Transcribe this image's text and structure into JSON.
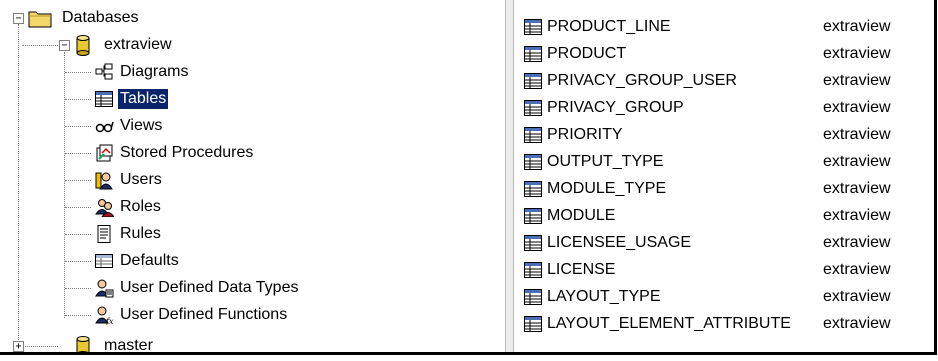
{
  "tree": {
    "root": {
      "label": "Databases",
      "expander": "−"
    },
    "database": {
      "label": "extraview",
      "expander": "−"
    },
    "items": [
      {
        "label": "Diagrams",
        "icon": "diagram-icon"
      },
      {
        "label": "Tables",
        "icon": "table-icon",
        "selected": true
      },
      {
        "label": "Views",
        "icon": "glasses-icon"
      },
      {
        "label": "Stored Procedures",
        "icon": "stored-procedure-icon"
      },
      {
        "label": "Users",
        "icon": "user-icon"
      },
      {
        "label": "Roles",
        "icon": "roles-icon"
      },
      {
        "label": "Rules",
        "icon": "rules-icon"
      },
      {
        "label": "Defaults",
        "icon": "defaults-icon"
      },
      {
        "label": "User Defined Data Types",
        "icon": "udt-icon"
      },
      {
        "label": "User Defined Functions",
        "icon": "udf-icon"
      }
    ],
    "next_database": {
      "label": "master",
      "expander": "+"
    }
  },
  "tables": [
    {
      "name": "PRODUCT_LINE",
      "owner": "extraview"
    },
    {
      "name": "PRODUCT",
      "owner": "extraview"
    },
    {
      "name": "PRIVACY_GROUP_USER",
      "owner": "extraview"
    },
    {
      "name": "PRIVACY_GROUP",
      "owner": "extraview"
    },
    {
      "name": "PRIORITY",
      "owner": "extraview"
    },
    {
      "name": "OUTPUT_TYPE",
      "owner": "extraview"
    },
    {
      "name": "MODULE_TYPE",
      "owner": "extraview"
    },
    {
      "name": "MODULE",
      "owner": "extraview"
    },
    {
      "name": "LICENSEE_USAGE",
      "owner": "extraview"
    },
    {
      "name": "LICENSE",
      "owner": "extraview"
    },
    {
      "name": "LAYOUT_TYPE",
      "owner": "extraview"
    },
    {
      "name": "LAYOUT_ELEMENT_ATTRIBUTE",
      "owner": "extraview"
    }
  ],
  "colors": {
    "selection": "#0a246a",
    "folder": "#f4d86b",
    "database": "#e8c830"
  }
}
